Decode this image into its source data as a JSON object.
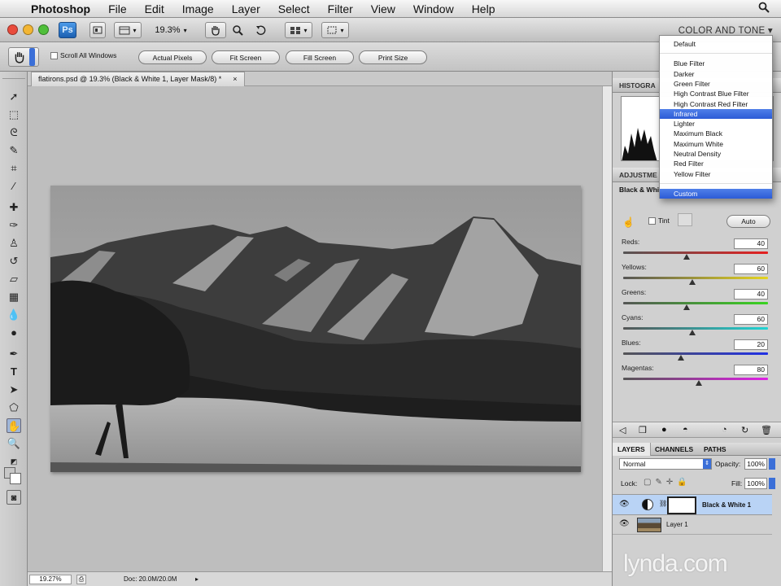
{
  "menubar": {
    "app_name": "Photoshop",
    "items": [
      "File",
      "Edit",
      "Image",
      "Layer",
      "Select",
      "Filter",
      "View",
      "Window",
      "Help"
    ]
  },
  "appbar": {
    "zoom": "19.3%",
    "workspace": "COLOR AND TONE ▾"
  },
  "options": {
    "scroll_all_windows": "Scroll All Windows",
    "buttons": [
      "Actual Pixels",
      "Fit Screen",
      "Fill Screen",
      "Print Size"
    ]
  },
  "document": {
    "tab_title": "flatirons.psd @ 19.3% (Black & White 1, Layer Mask/8) *",
    "status_zoom": "19.27%",
    "status_doc": "Doc: 20.0M/20.0M"
  },
  "panels": {
    "histogram_title": "HISTOGRA",
    "adjustments_title": "ADJUSTME",
    "bw_preset_label": "Black & Whi",
    "tint_label": "Tint",
    "auto_label": "Auto",
    "sliders": [
      {
        "label": "Reds:",
        "value": "40",
        "pct": 0.44
      },
      {
        "label": "Yellows:",
        "value": "60",
        "pct": 0.48
      },
      {
        "label": "Greens:",
        "value": "40",
        "pct": 0.44
      },
      {
        "label": "Cyans:",
        "value": "60",
        "pct": 0.48
      },
      {
        "label": "Blues:",
        "value": "20",
        "pct": 0.4
      },
      {
        "label": "Magentas:",
        "value": "80",
        "pct": 0.52
      }
    ],
    "layers_tabs": [
      "LAYERS",
      "CHANNELS",
      "PATHS"
    ],
    "blend_mode": "Normal",
    "opacity_label": "Opacity:",
    "opacity_value": "100%",
    "lock_label": "Lock:",
    "fill_label": "Fill:",
    "fill_value": "100%",
    "layers": [
      {
        "name": "Black & White 1",
        "selected": true
      },
      {
        "name": "Layer 1",
        "selected": false
      }
    ]
  },
  "preset_menu": {
    "items": [
      "Default",
      "Blue Filter",
      "Darker",
      "Green Filter",
      "High Contrast Blue Filter",
      "High Contrast Red Filter",
      "Infrared",
      "Lighter",
      "Maximum Black",
      "Maximum White",
      "Neutral Density",
      "Red Filter",
      "Yellow Filter",
      "Custom"
    ],
    "highlighted": [
      "Infrared",
      "Custom"
    ]
  },
  "watermark": "lynda.com",
  "colors": {
    "menu_highlight": "#2c5bd6",
    "layer_selected": "#b9d3f5"
  }
}
